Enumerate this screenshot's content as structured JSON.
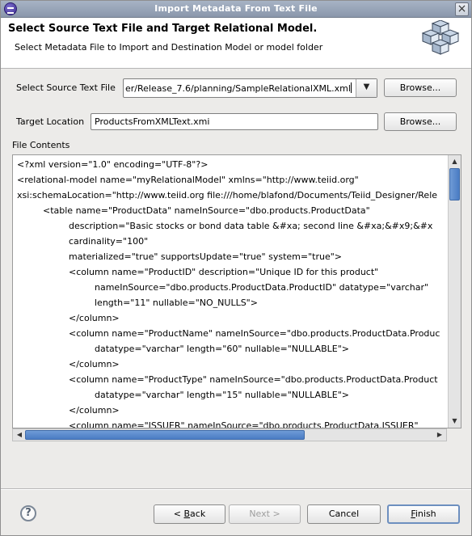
{
  "window": {
    "title": "Import Metadata From Text File"
  },
  "header": {
    "title": "Select Source Text File and Target Relational Model.",
    "subtitle": "Select Metadata File to Import and Destination Model or model folder"
  },
  "source": {
    "label": "Select Source Text File",
    "value": "er/Release_7.6/planning/SampleRelationalXML.xml",
    "browse_label": "Browse..."
  },
  "target": {
    "label": "Target Location",
    "value": "ProductsFromXMLText.xmi",
    "browse_label": "Browse..."
  },
  "file_contents": {
    "label": "File Contents",
    "lines": [
      "<?xml version=\"1.0\" encoding=\"UTF-8\"?>",
      "<relational-model name=\"myRelationalModel\" xmlns=\"http://www.teiid.org\"",
      "xsi:schemaLocation=\"http://www.teiid.org file:///home/blafond/Documents/Teiid_Designer/Rele",
      "<table name=\"ProductData\" nameInSource=\"dbo.products.ProductData\"",
      "description=\"Basic stocks or bond data table &#xa; second line &#xa;&#x9;&#x",
      "cardinality=\"100\"",
      "materialized=\"true\" supportsUpdate=\"true\" system=\"true\">",
      "<column name=\"ProductID\" description=\"Unique ID for this product\"",
      "nameInSource=\"dbo.products.ProductData.ProductID\" datatype=\"varchar\"",
      "length=\"11\" nullable=\"NO_NULLS\">",
      "</column>",
      "<column name=\"ProductName\" nameInSource=\"dbo.products.ProductData.Produc",
      "datatype=\"varchar\" length=\"60\" nullable=\"NULLABLE\">",
      "</column>",
      "<column name=\"ProductType\" nameInSource=\"dbo.products.ProductData.Product",
      "datatype=\"varchar\" length=\"15\" nullable=\"NULLABLE\">",
      "</column>",
      "<column name=\"ISSUER\" nameInSource=\"dbo.products.ProductData.ISSUER\""
    ]
  },
  "footer": {
    "back_pre": "< ",
    "back_mn": "B",
    "back_post": "ack",
    "next_label": "Next >",
    "cancel_label": "Cancel",
    "finish_mn": "F",
    "finish_post": "inish",
    "help_glyph": "?"
  }
}
